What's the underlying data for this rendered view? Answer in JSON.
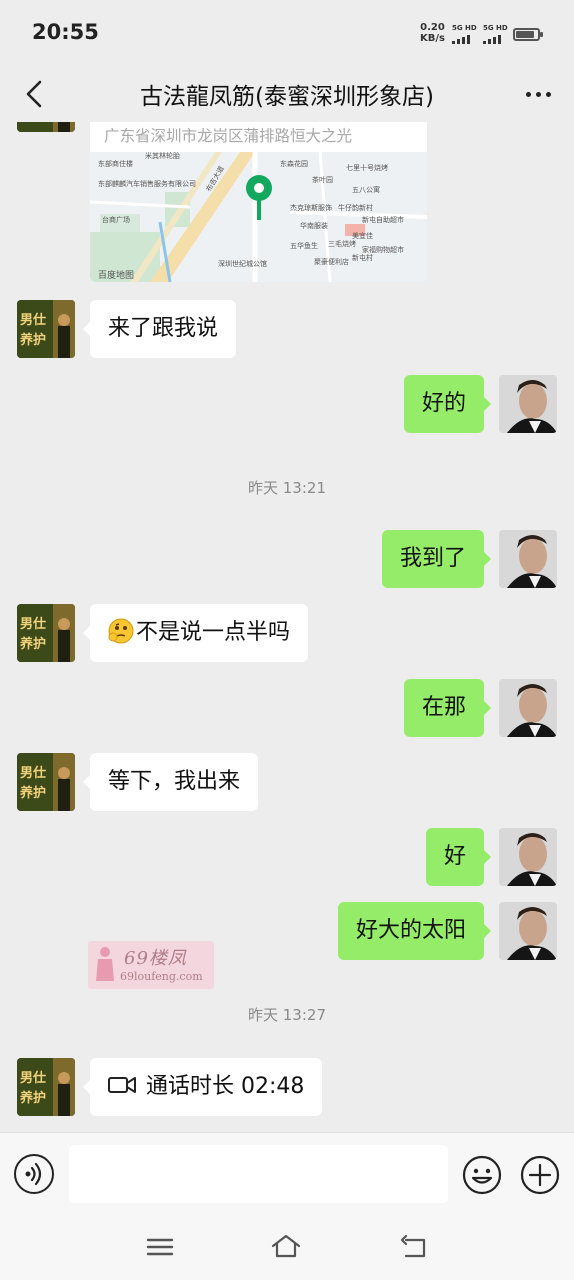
{
  "status_bar": {
    "time": "20:55",
    "net_speed_value": "0.20",
    "net_speed_unit": "KB/s",
    "sim1_label": "5G HD",
    "sim2_label": "5G HD",
    "battery_level": 0.85
  },
  "header": {
    "title": "古法龍凤筋(泰蜜深圳形象店)"
  },
  "location_card": {
    "address": "广东省深圳市龙岗区蒲排路恒大之光",
    "map_labels": [
      "东部商住楼",
      "东部麒麟汽车销售服务有限公司",
      "米其林轮胎",
      "东森花园",
      "七里十号烧烤",
      "茶叶园",
      "五八公寓",
      "牛仔韵新村",
      "华南服装",
      "杰克琼斯服饰",
      "三毛烧烤",
      "美宜佳",
      "新屯自助超市",
      "家福购物超市",
      "五华鱼生",
      "聚豪便利店",
      "深圳世纪城公馆",
      "布吉大道",
      "百度地图",
      "新屯村",
      "台商广场"
    ]
  },
  "messages": [
    {
      "side": "left",
      "text": "来了跟我说"
    },
    {
      "side": "right",
      "text": "好的"
    },
    {
      "side": "time",
      "text": "昨天 13:21"
    },
    {
      "side": "right",
      "text": "我到了"
    },
    {
      "side": "left",
      "text": "不是说一点半吗",
      "emoji": "thinking-face"
    },
    {
      "side": "right",
      "text": "在那"
    },
    {
      "side": "left",
      "text": "等下，我出来"
    },
    {
      "side": "right",
      "text": "好"
    },
    {
      "side": "right",
      "text": "好大的太阳"
    },
    {
      "side": "time",
      "text": "昨天 13:27"
    },
    {
      "side": "left",
      "text": "通话时长 02:48",
      "icon": "video-call-icon"
    }
  ],
  "contact_avatar_text": [
    "男仕",
    "养护"
  ],
  "watermark": {
    "title": "69楼凤",
    "url": "69loufeng.com"
  },
  "input_bar": {
    "value": "",
    "placeholder": ""
  },
  "icons": {
    "back": "back-arrow-icon",
    "more": "more-dots-icon",
    "voice": "voice-icon",
    "emoji": "emoji-icon",
    "plus": "plus-icon",
    "menu": "menu-icon",
    "home": "home-icon",
    "return": "return-icon"
  },
  "colors": {
    "background": "#ededed",
    "bubble_self": "#95ec69",
    "bubble_other": "#ffffff",
    "timestamp": "#8a8a8a",
    "map_pin": "#13a85e"
  }
}
